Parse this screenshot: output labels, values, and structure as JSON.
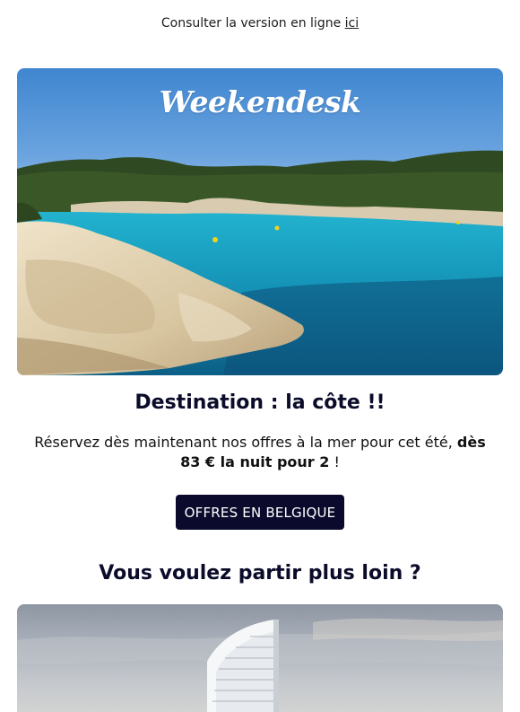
{
  "header": {
    "view_online_prefix": "Consulter la version en ligne ",
    "view_online_link": "ici"
  },
  "hero": {
    "logo_text": "Weekendesk",
    "image_alt": "Crique turquoise bordée de rochers et de pins"
  },
  "section1": {
    "title": "Destination : la côte !!",
    "text_before": "Réservez dès maintenant nos offres à la mer pour cet été, ",
    "text_bold": "dès 83 € la nuit pour 2",
    "text_after": " !",
    "cta_label": "OFFRES EN BELGIQUE"
  },
  "section2": {
    "title": "Vous voulez partir plus loin ?",
    "image_alt": "Hôtel en forme de voile au bord de la mer"
  },
  "colors": {
    "cta_background": "#0b0a2c",
    "heading": "#0b0b2a",
    "sea": "#1f9ec0"
  }
}
